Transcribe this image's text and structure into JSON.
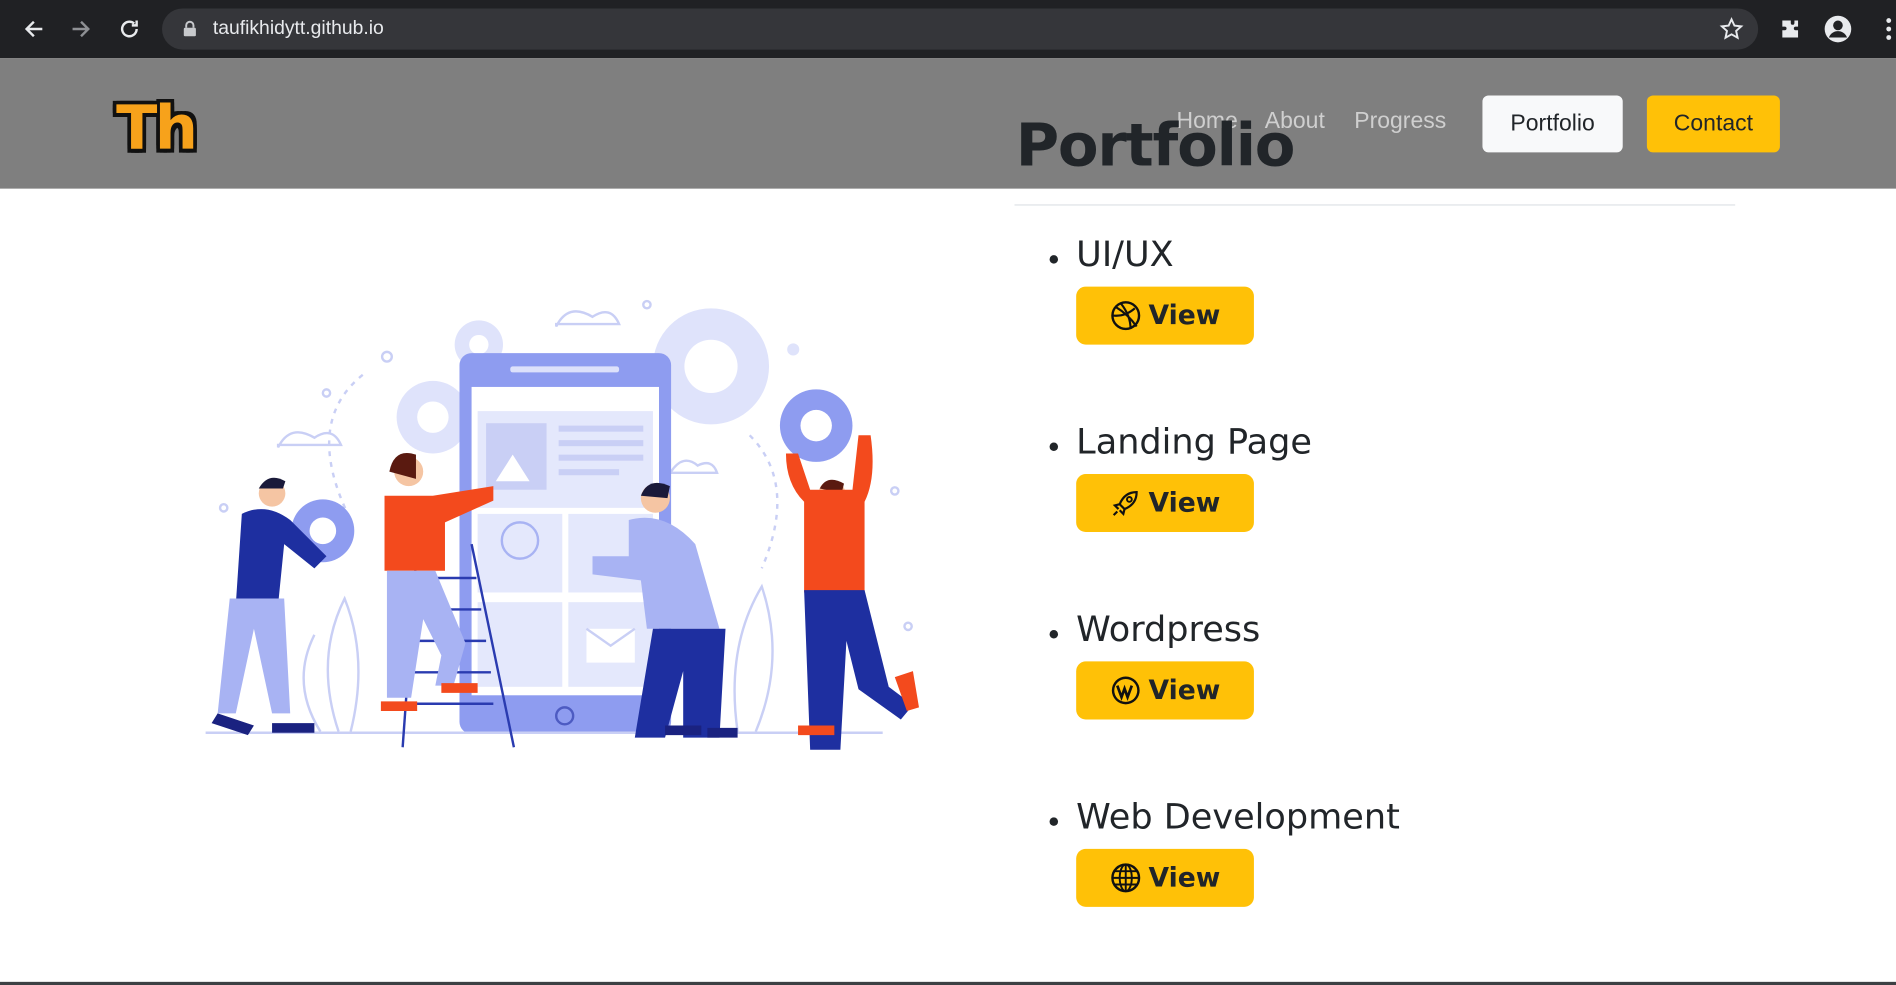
{
  "browser": {
    "url": "taufikhidytt.github.io"
  },
  "site": {
    "logo": "Th",
    "nav": {
      "home": "Home",
      "about": "About",
      "progress": "Progress",
      "portfolio": "Portfolio",
      "contact": "Contact"
    },
    "title": "Portfolio"
  },
  "portfolio": {
    "items": [
      {
        "label": "UI/UX",
        "button": "View",
        "icon": "dribbble-icon"
      },
      {
        "label": "Landing Page",
        "button": "View",
        "icon": "rocket-icon"
      },
      {
        "label": "Wordpress",
        "button": "View",
        "icon": "wordpress-icon"
      },
      {
        "label": "Web Development",
        "button": "View",
        "icon": "globe-icon"
      }
    ]
  },
  "colors": {
    "header_bg": "#7f7f7f",
    "accent": "#ffc107",
    "logo": "#f7a21b",
    "illustration_blue": "#8e9cf0",
    "illustration_orange": "#f34a1d",
    "illustration_navy": "#1e2fa0"
  }
}
